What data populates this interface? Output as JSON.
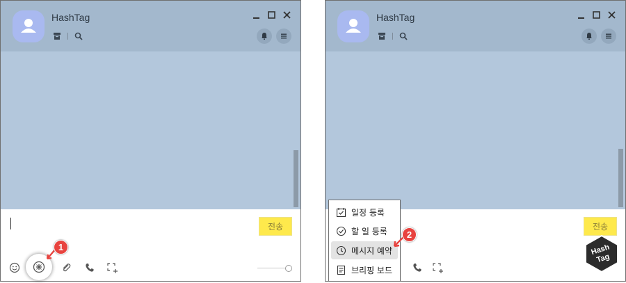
{
  "app": {
    "chat_title": "HashTag",
    "send_label": "전송"
  },
  "menu": {
    "items": [
      {
        "label": "일정 등록",
        "icon": "calendar-check-icon"
      },
      {
        "label": "할 일 등록",
        "icon": "check-circle-icon"
      },
      {
        "label": "메시지 예약",
        "icon": "clock-icon",
        "highlighted": true
      },
      {
        "label": "브리핑 보드",
        "icon": "document-icon"
      }
    ]
  },
  "annotations": {
    "step1": "1",
    "step2": "2"
  },
  "watermark": {
    "text": "HashTag"
  },
  "colors": {
    "header": "#a3b8cd",
    "chat_bg": "#b3c7dc",
    "send_button": "#fee94c",
    "badge": "#e8433f"
  }
}
